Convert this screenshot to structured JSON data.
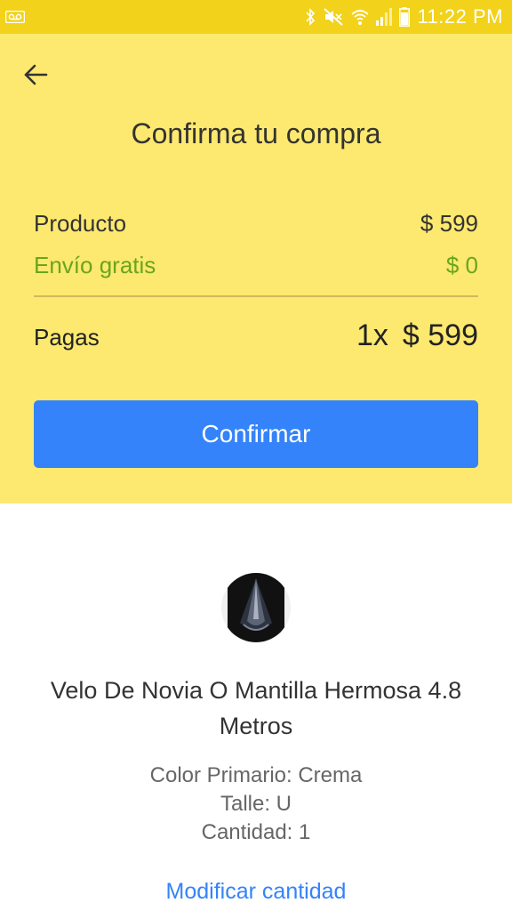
{
  "status_bar": {
    "time": "11:22 PM",
    "icons": [
      "voicemail-icon",
      "bluetooth-icon",
      "mute-icon",
      "wifi-icon",
      "signal-icon",
      "battery-icon"
    ],
    "background": "#f2d21b"
  },
  "header": {
    "back_icon": "arrow-left-icon",
    "title": "Confirma tu compra"
  },
  "summary": {
    "product_label": "Producto",
    "product_price": "$ 599",
    "shipping_label": "Envío gratis",
    "shipping_price": "$ 0",
    "total_label": "Pagas",
    "total_quantity": "1x",
    "total_price": "$ 599"
  },
  "confirm_button": {
    "label": "Confirmar",
    "color": "#3483fa"
  },
  "product": {
    "title": "Velo De Novia O Mantilla Hermosa 4.8 Metros",
    "attributes": [
      "Color Primario: Crema",
      "Talle: U",
      "Cantidad: 1"
    ],
    "modify_label": "Modificar cantidad"
  },
  "colors": {
    "panel_yellow": "#fde96f",
    "shipping_green": "#6aa51e",
    "link_blue": "#3483fa"
  }
}
